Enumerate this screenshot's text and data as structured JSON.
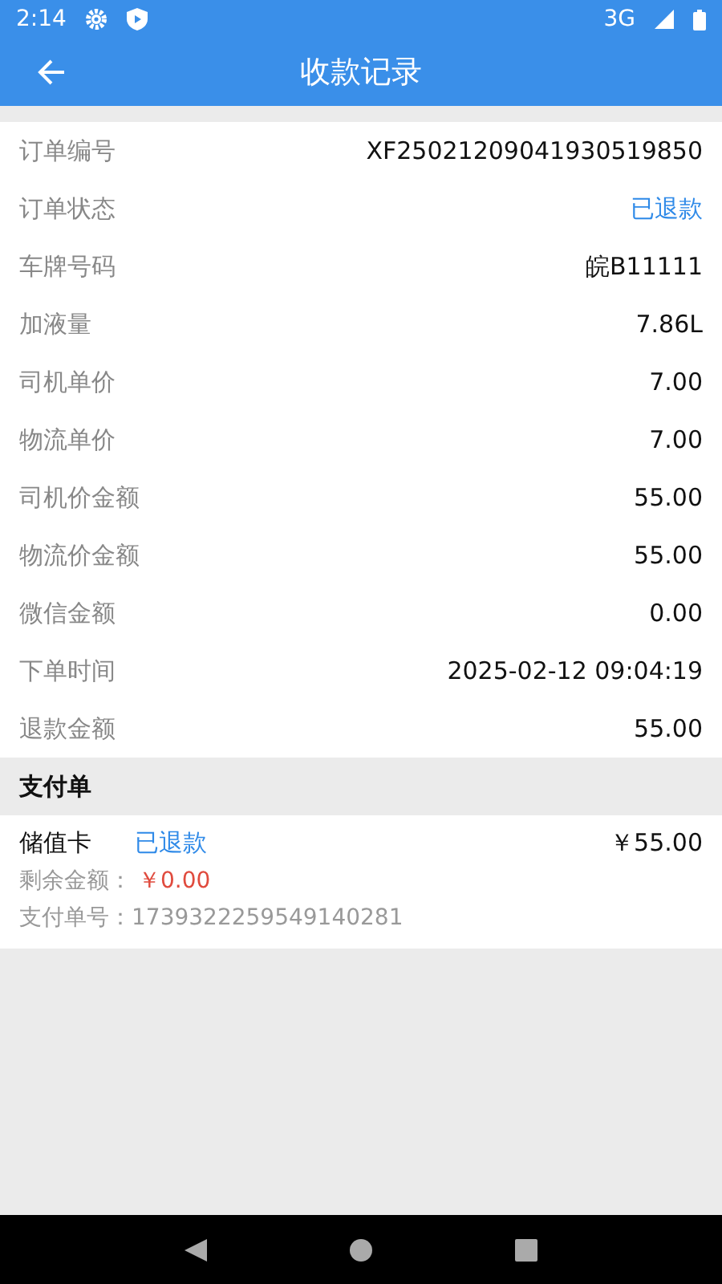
{
  "status_bar": {
    "time": "2:14",
    "network": "3G"
  },
  "app_bar": {
    "title": "收款记录"
  },
  "details": [
    {
      "label": "订单编号",
      "value": "XF25021209041930519850",
      "kind": "plain"
    },
    {
      "label": "订单状态",
      "value": "已退款",
      "kind": "status"
    },
    {
      "label": "车牌号码",
      "value": "皖B11111",
      "kind": "plain"
    },
    {
      "label": "加液量",
      "value": "7.86L",
      "kind": "plain"
    },
    {
      "label": "司机单价",
      "value": "7.00",
      "kind": "plain"
    },
    {
      "label": "物流单价",
      "value": "7.00",
      "kind": "plain"
    },
    {
      "label": "司机价金额",
      "value": "55.00",
      "kind": "plain"
    },
    {
      "label": "物流价金额",
      "value": "55.00",
      "kind": "plain"
    },
    {
      "label": "微信金额",
      "value": "0.00",
      "kind": "plain"
    },
    {
      "label": "下单时间",
      "value": "2025-02-12 09:04:19",
      "kind": "plain"
    },
    {
      "label": "退款金额",
      "value": "55.00",
      "kind": "plain"
    }
  ],
  "payment_section": {
    "title": "支付单",
    "items": [
      {
        "method": "储值卡",
        "status": "已退款",
        "amount": "￥55.00",
        "balance_label": "剩余金额：",
        "balance": "￥0.00",
        "number_label": "支付单号：",
        "number": "1739322259549140281"
      }
    ]
  }
}
